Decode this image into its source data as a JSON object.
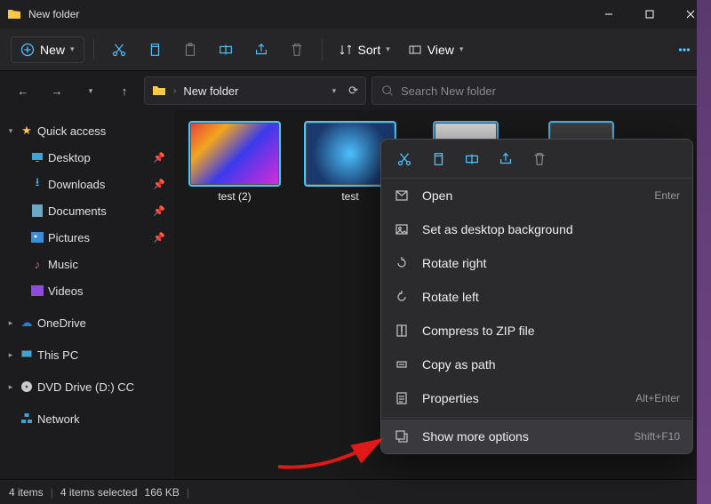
{
  "window": {
    "title": "New folder"
  },
  "toolbar": {
    "new_label": "New",
    "sort_label": "Sort",
    "view_label": "View"
  },
  "nav": {
    "breadcrumb": "New folder"
  },
  "search": {
    "placeholder": "Search New folder"
  },
  "sidebar": {
    "quick_access": "Quick access",
    "items": [
      {
        "label": "Desktop"
      },
      {
        "label": "Downloads"
      },
      {
        "label": "Documents"
      },
      {
        "label": "Pictures"
      },
      {
        "label": "Music"
      },
      {
        "label": "Videos"
      }
    ],
    "onedrive": "OneDrive",
    "thispc": "This PC",
    "dvd": "DVD Drive (D:) CC",
    "network": "Network"
  },
  "files": [
    {
      "name": "test (2)"
    },
    {
      "name": "test"
    }
  ],
  "context_menu": {
    "items": [
      {
        "label": "Open",
        "shortcut": "Enter"
      },
      {
        "label": "Set as desktop background",
        "shortcut": ""
      },
      {
        "label": "Rotate right",
        "shortcut": ""
      },
      {
        "label": "Rotate left",
        "shortcut": ""
      },
      {
        "label": "Compress to ZIP file",
        "shortcut": ""
      },
      {
        "label": "Copy as path",
        "shortcut": ""
      },
      {
        "label": "Properties",
        "shortcut": "Alt+Enter"
      },
      {
        "label": "Show more options",
        "shortcut": "Shift+F10"
      }
    ]
  },
  "status": {
    "count": "4 items",
    "selected": "4 items selected",
    "size": "166 KB"
  },
  "colors": {
    "accent": "#4cc2ff"
  }
}
